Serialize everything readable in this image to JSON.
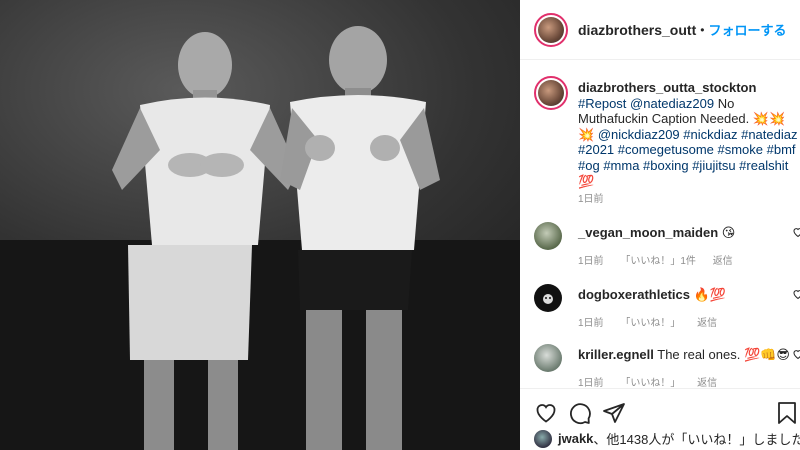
{
  "post": {
    "username": "diazbrothers_outt",
    "follow_label": "フォローする",
    "separator": "•"
  },
  "caption": {
    "username": "diazbrothers_outta_stockton",
    "parts": [
      {
        "type": "tag",
        "text": "#Repost"
      },
      {
        "type": "tag",
        "text": "@natediaz209"
      },
      {
        "type": "text",
        "text": " No Muthafuckin Caption Needed. 💥💥💥 "
      },
      {
        "type": "tag",
        "text": "@nickdiaz209"
      },
      {
        "type": "tag",
        "text": "#nickdiaz"
      },
      {
        "type": "tag",
        "text": "#natediaz"
      },
      {
        "type": "tag",
        "text": "#2021"
      },
      {
        "type": "tag",
        "text": "#comegetusome"
      },
      {
        "type": "tag",
        "text": "#smoke"
      },
      {
        "type": "tag",
        "text": "#bmf"
      },
      {
        "type": "tag",
        "text": "#og"
      },
      {
        "type": "tag",
        "text": "#mma"
      },
      {
        "type": "tag",
        "text": "#boxing"
      },
      {
        "type": "tag",
        "text": "#jiujitsu"
      },
      {
        "type": "tag",
        "text": "#realshit"
      },
      {
        "type": "text",
        "text": " 💯"
      }
    ],
    "time": "1日前"
  },
  "comments": [
    {
      "username": "_vegan_moon_maiden",
      "text": " 😘",
      "time": "1日前",
      "likes": "「いいね！」1件",
      "reply": "返信",
      "avatar_color": "#7a8a6a"
    },
    {
      "username": "dogboxerathletics",
      "text": " 🔥💯",
      "time": "1日前",
      "likes": "「いいね！」",
      "reply": "返信",
      "avatar_color": "#111111"
    },
    {
      "username": "kriller.egnell",
      "text": " The real ones. 💯👊😎",
      "time": "1日前",
      "likes": "「いいね！」",
      "reply": "返信",
      "avatar_color": "#9aa7a0"
    }
  ],
  "likes_line": {
    "user": "jwakk",
    "rest": "、他1438人が「いいね！」しました"
  }
}
